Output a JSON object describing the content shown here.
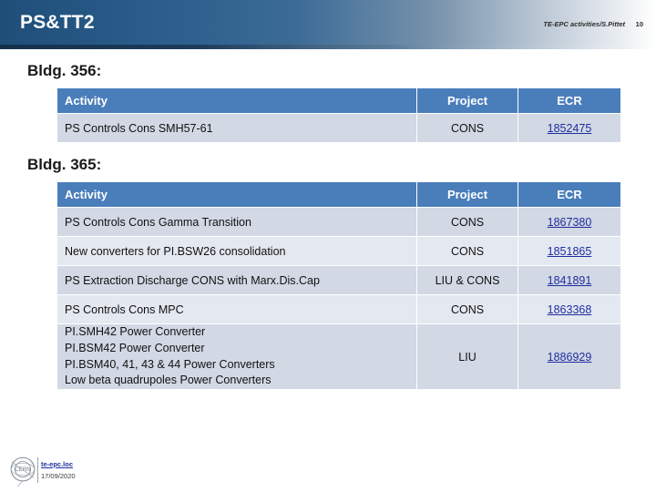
{
  "header": {
    "title": "PS&TT2",
    "meta": "TE-EPC activities/S.Pittet",
    "page_number": "10",
    "accent_color": "#1f4e79"
  },
  "sections": [
    {
      "heading": "Bldg. 356:",
      "columns": [
        "Activity",
        "Project",
        "ECR"
      ],
      "rows": [
        {
          "activity": "PS Controls Cons SMH57-61",
          "project": "CONS",
          "ecr": "1852475"
        }
      ]
    },
    {
      "heading": "Bldg. 365:",
      "columns": [
        "Activity",
        "Project",
        "ECR"
      ],
      "rows": [
        {
          "activity": "PS Controls Cons Gamma Transition",
          "project": "CONS",
          "ecr": "1867380"
        },
        {
          "activity": "New converters for PI.BSW26 consolidation",
          "project": "CONS",
          "ecr": "1851865"
        },
        {
          "activity": "PS Extraction Discharge CONS with Marx.Dis.Cap",
          "project": "LIU & CONS",
          "ecr": "1841891"
        },
        {
          "activity": "PS Controls Cons MPC",
          "project": "CONS",
          "ecr": "1863368"
        },
        {
          "activity_lines": [
            "PI.SMH42 Power Converter",
            "PI.BSM42 Power Converter",
            "PI.BSM40, 41, 43 & 44 Power Converters",
            "Low beta quadrupoles Power Converters"
          ],
          "project": "LIU",
          "ecr": "1886929"
        }
      ]
    }
  ],
  "footer": {
    "logo_text": "CERN",
    "link": "te-epc.loc",
    "date": "17/09/2020"
  },
  "theme": {
    "table_header_bg": "#4a7ebb",
    "row_band_a": "#d2d8e4",
    "row_band_b": "#e4e8f0",
    "link_color": "#1f2ea0"
  }
}
